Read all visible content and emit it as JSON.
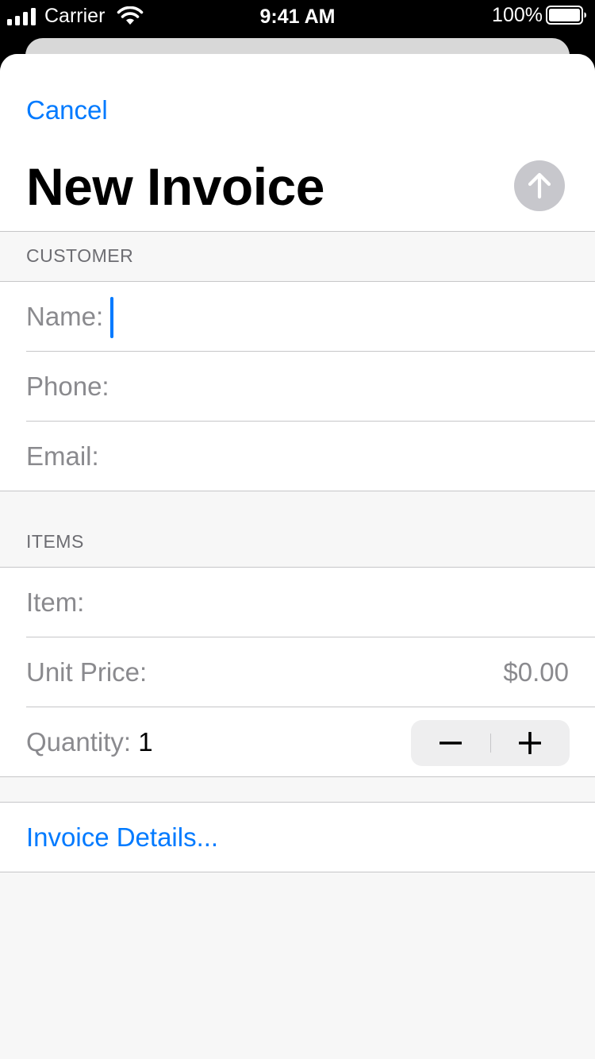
{
  "status_bar": {
    "carrier": "Carrier",
    "time": "9:41 AM",
    "battery": "100%"
  },
  "nav": {
    "cancel_label": "Cancel",
    "title": "New Invoice",
    "send_icon": "arrow-up-circle-icon"
  },
  "customer": {
    "header": "CUSTOMER",
    "name_label": "Name:",
    "name_value": "",
    "phone_label": "Phone:",
    "phone_value": "",
    "email_label": "Email:",
    "email_value": ""
  },
  "items": {
    "header": "ITEMS",
    "item_label": "Item:",
    "item_value": "",
    "unit_price_label": "Unit Price:",
    "unit_price_value": "$0.00",
    "quantity_label": "Quantity:",
    "quantity_value": "1",
    "decrement_icon": "minus-icon",
    "increment_icon": "plus-icon"
  },
  "details": {
    "link_label": "Invoice Details..."
  },
  "colors": {
    "accent": "#007aff",
    "label_gray": "#8a8a8e",
    "separator": "#c6c6c8",
    "background": "#f7f7f7"
  }
}
